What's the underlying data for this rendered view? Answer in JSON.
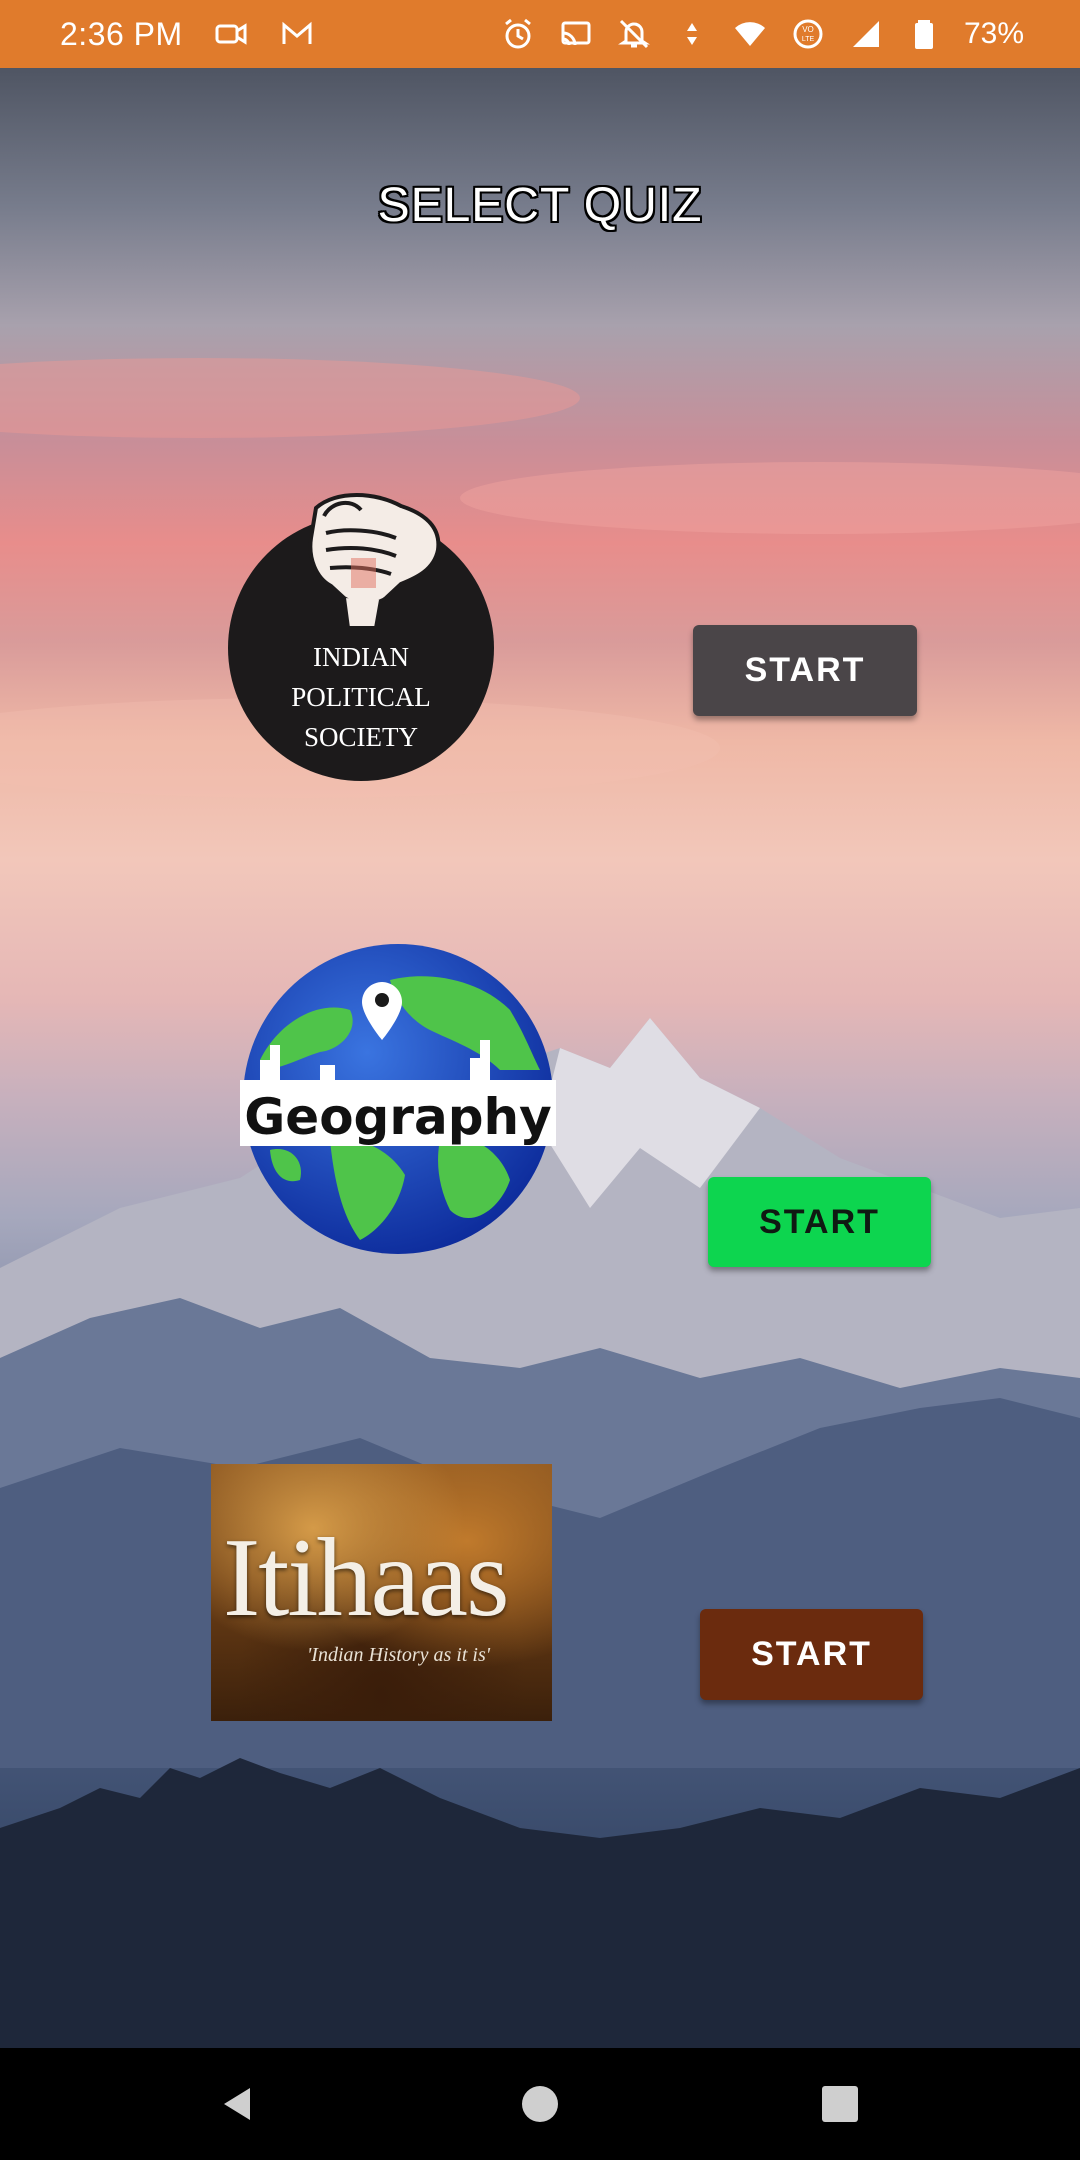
{
  "status_bar": {
    "time": "2:36 PM",
    "battery_percent": "73%",
    "left_icons": [
      "video-camera-icon",
      "gmail-icon"
    ],
    "right_icons": [
      "alarm-icon",
      "cast-icon",
      "mute-icon",
      "data-arrows-icon",
      "wifi-icon",
      "volte-icon",
      "signal-icon",
      "battery-icon"
    ],
    "background_color": "#e07b2c"
  },
  "screen": {
    "title": "SELECT QUIZ"
  },
  "quizzes": [
    {
      "logo_lines": [
        "INDIAN",
        "POLITICAL",
        "SOCIETY"
      ],
      "button_label": "START",
      "button_color": "#4a4548"
    },
    {
      "logo_text": "Geography",
      "button_label": "START",
      "button_color": "#0dd54f"
    },
    {
      "logo_text": "Itihaas",
      "logo_tagline": "'Indian History as it is'",
      "button_label": "START",
      "button_color": "#6b2b0e"
    }
  ],
  "nav_bar": {
    "icons": [
      "back-icon",
      "home-icon",
      "recents-icon"
    ]
  }
}
